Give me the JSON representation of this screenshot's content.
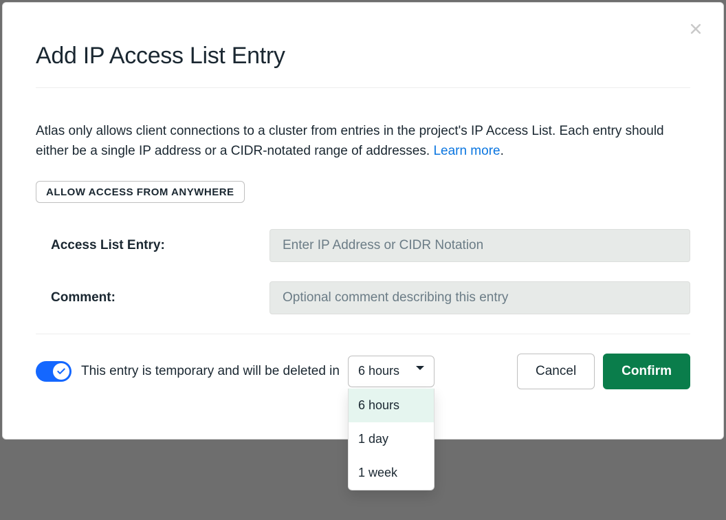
{
  "modal": {
    "title": "Add IP Access List Entry",
    "description_text": "Atlas only allows client connections to a cluster from entries in the project's IP Access List. Each entry should either be a single IP address or a CIDR-notated range of addresses. ",
    "learn_more": "Learn more",
    "allow_anywhere": "ALLOW ACCESS FROM ANYWHERE",
    "fields": {
      "access_label": "Access List Entry:",
      "access_placeholder": "Enter IP Address or CIDR Notation",
      "access_value": "",
      "comment_label": "Comment:",
      "comment_placeholder": "Optional comment describing this entry",
      "comment_value": ""
    },
    "temporary": {
      "enabled": true,
      "label": "This entry is temporary and will be deleted in",
      "selected": "6 hours",
      "options": [
        "6 hours",
        "1 day",
        "1 week"
      ]
    },
    "buttons": {
      "cancel": "Cancel",
      "confirm": "Confirm"
    }
  }
}
